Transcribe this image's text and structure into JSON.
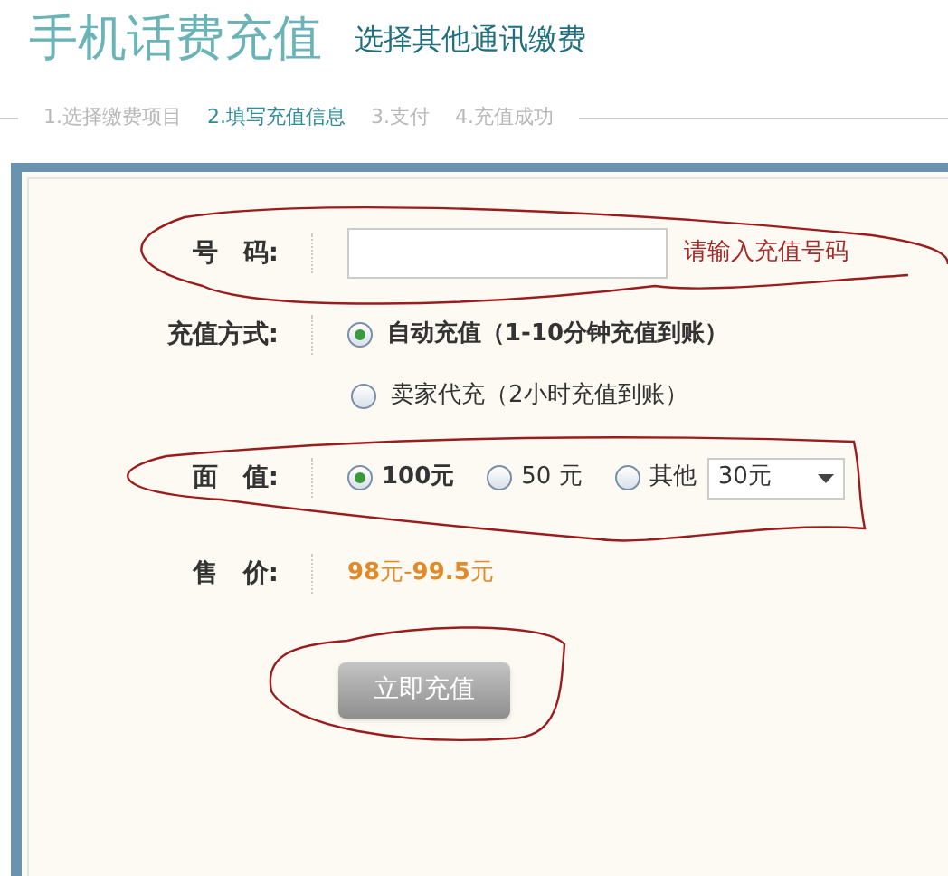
{
  "title": "手机话费充值",
  "other_link": "选择其他通讯缴费",
  "steps": [
    {
      "label": "1.选择缴费项目",
      "selected": false
    },
    {
      "label": "2.填写充值信息",
      "selected": true
    },
    {
      "label": "3.支付",
      "selected": false
    },
    {
      "label": "4.充值成功",
      "selected": false
    }
  ],
  "form": {
    "phone": {
      "label": "号　码:",
      "hint": "请输入充值号码"
    },
    "method": {
      "label": "充值方式:",
      "options": [
        {
          "label": "自动充值（1-10分钟充值到账）",
          "selected": true
        },
        {
          "label": "卖家代充（2小时充值到账）",
          "selected": false
        }
      ]
    },
    "amount": {
      "label": "面　值:",
      "options": [
        {
          "label": "100元",
          "selected": true
        },
        {
          "label": "50 元",
          "selected": false
        },
        {
          "label": "其他",
          "selected": false
        }
      ],
      "select_value": "30元"
    },
    "price": {
      "label": "售　价:",
      "value": "**98**元-**99.5**元"
    },
    "submit": "立即充值"
  }
}
